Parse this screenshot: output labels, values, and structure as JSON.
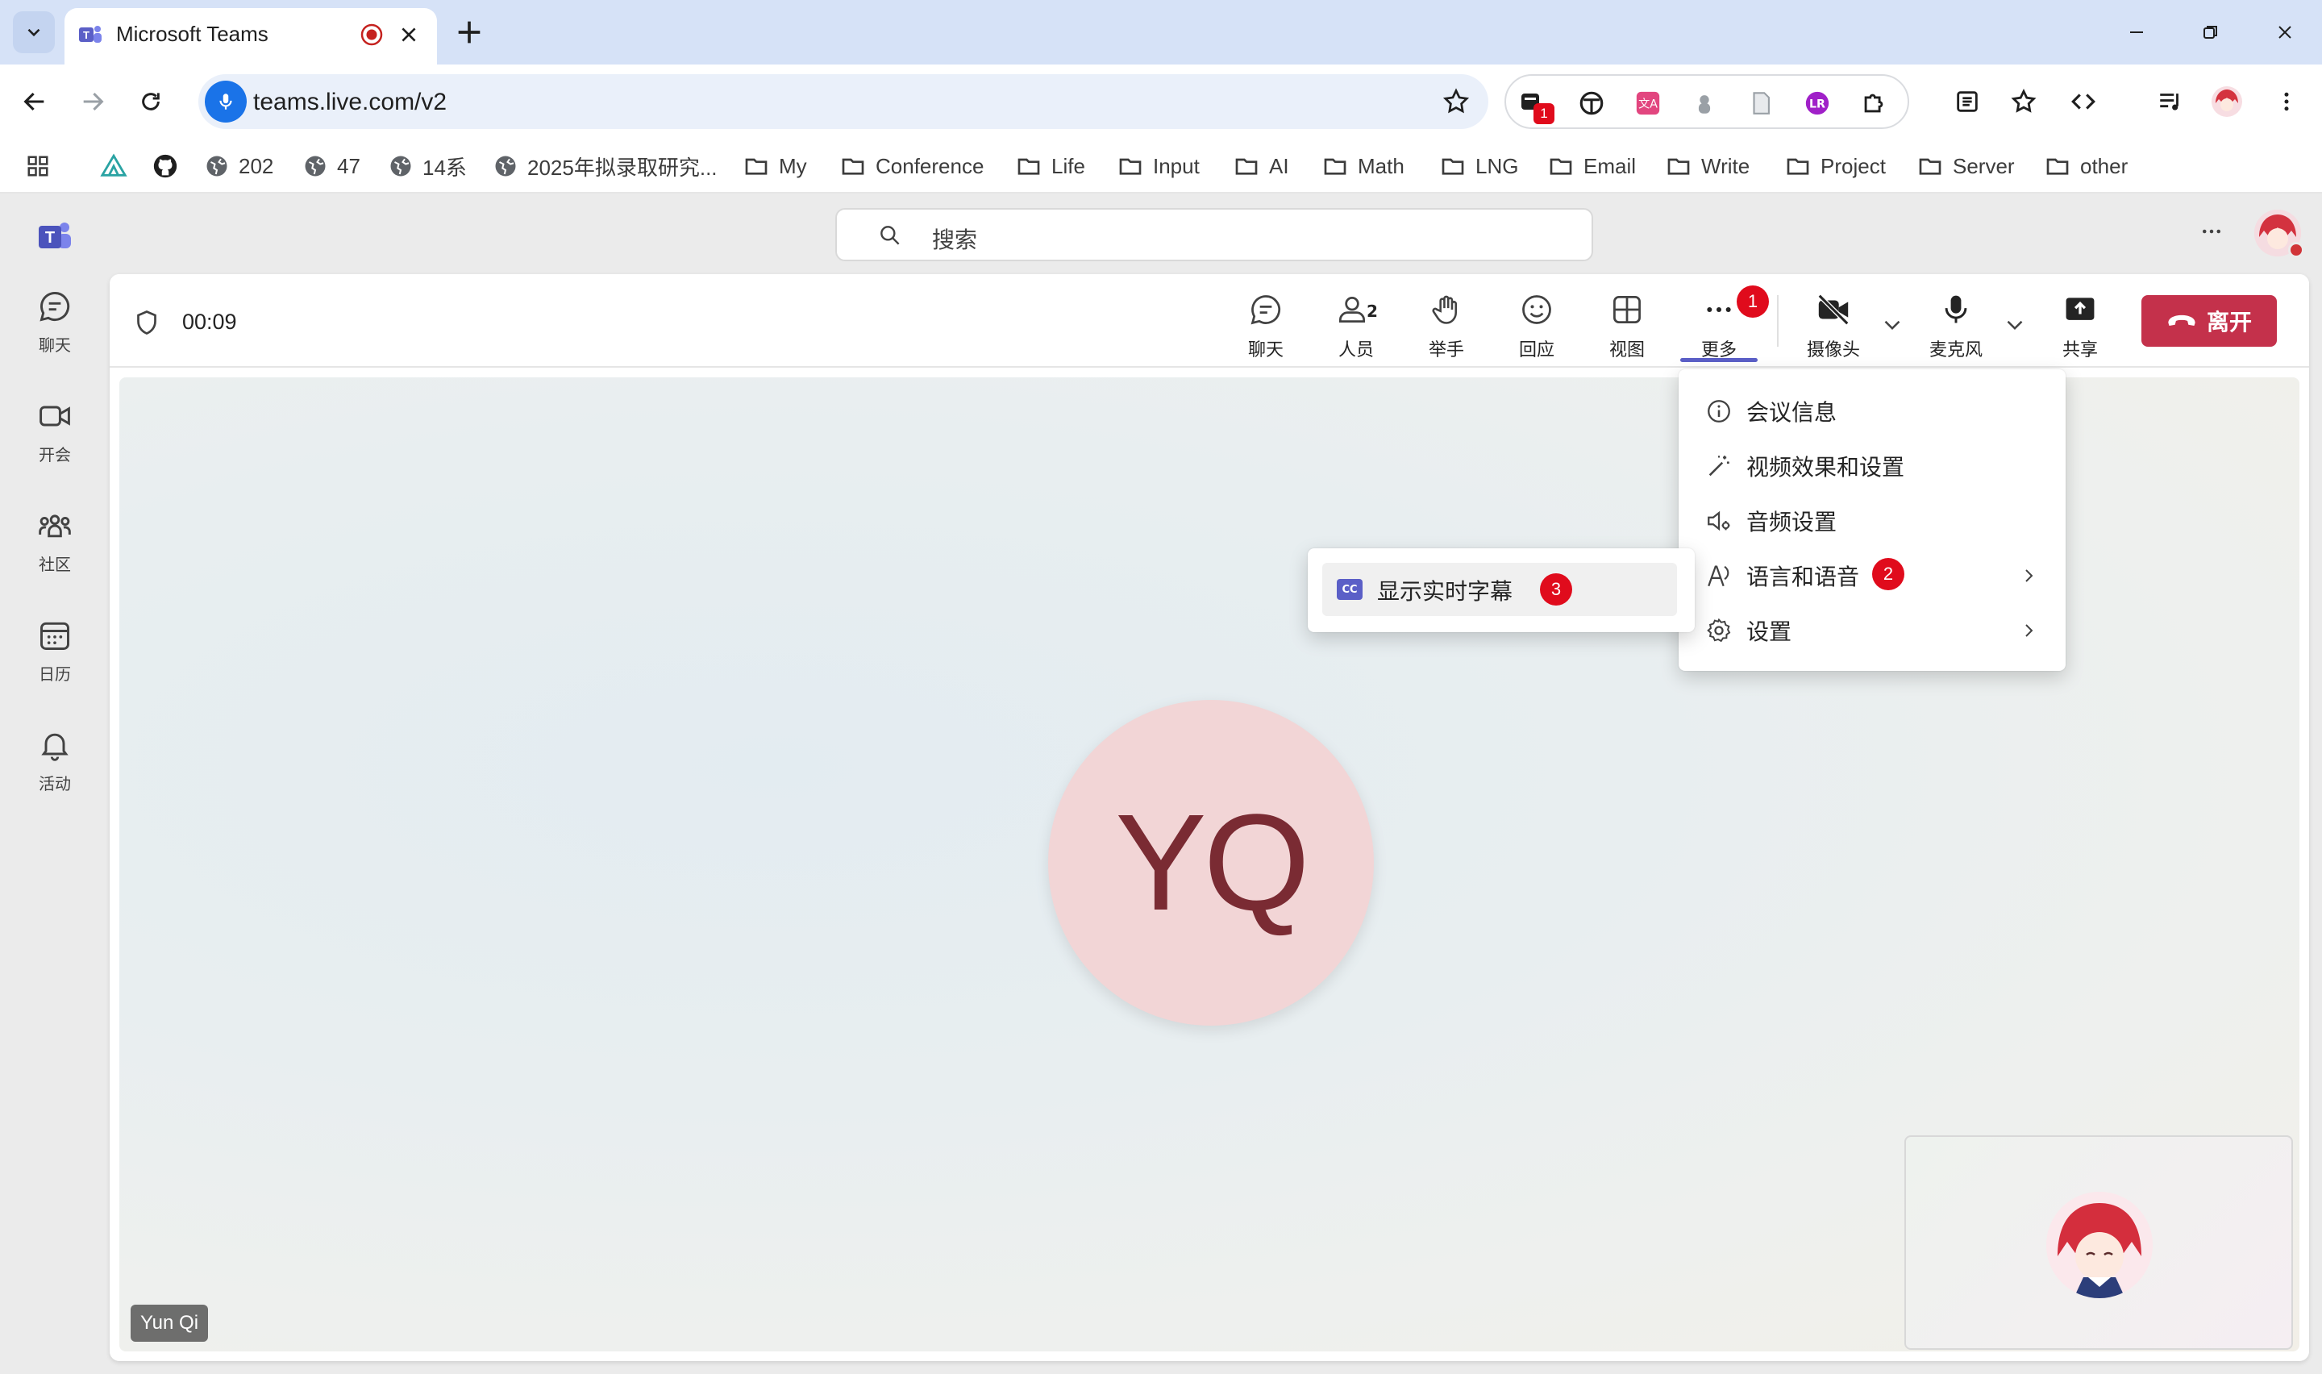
{
  "browser": {
    "tab_title": "Microsoft Teams",
    "url": "teams.live.com/v2",
    "extension_badge": "1",
    "bookmarks": [
      "202",
      "47",
      "14系",
      "2025年拟录取研究...",
      "My",
      "Conference",
      "Life",
      "Input",
      "AI",
      "Math",
      "LNG",
      "Email",
      "Write",
      "Project",
      "Server",
      "other"
    ]
  },
  "teams": {
    "search_placeholder": "搜索",
    "rail": [
      {
        "label": "聊天",
        "icon": "chat-icon"
      },
      {
        "label": "开会",
        "icon": "video-icon"
      },
      {
        "label": "社区",
        "icon": "community-icon"
      },
      {
        "label": "日历",
        "icon": "calendar-icon"
      },
      {
        "label": "活动",
        "icon": "bell-icon"
      }
    ],
    "meeting": {
      "timer": "00:09",
      "toolbar": {
        "chat": "聊天",
        "people": "人员",
        "people_count": "2",
        "raise_hand": "举手",
        "react": "回应",
        "view": "视图",
        "more": "更多",
        "camera": "摄像头",
        "mic": "麦克风",
        "share": "共享",
        "leave": "离开"
      },
      "step_badges": [
        "1",
        "2",
        "3"
      ],
      "participant_initials": "YQ",
      "participant_name": "Yun Qi",
      "more_menu": [
        "会议信息",
        "视频效果和设置",
        "音频设置",
        "语言和语音",
        "设置"
      ],
      "submenu": {
        "cc_icon": "CC",
        "item": "显示实时字幕"
      }
    }
  },
  "colors": {
    "accent": "#5b5fc7",
    "leave": "#c4314b",
    "badge": "#e00b1c"
  }
}
